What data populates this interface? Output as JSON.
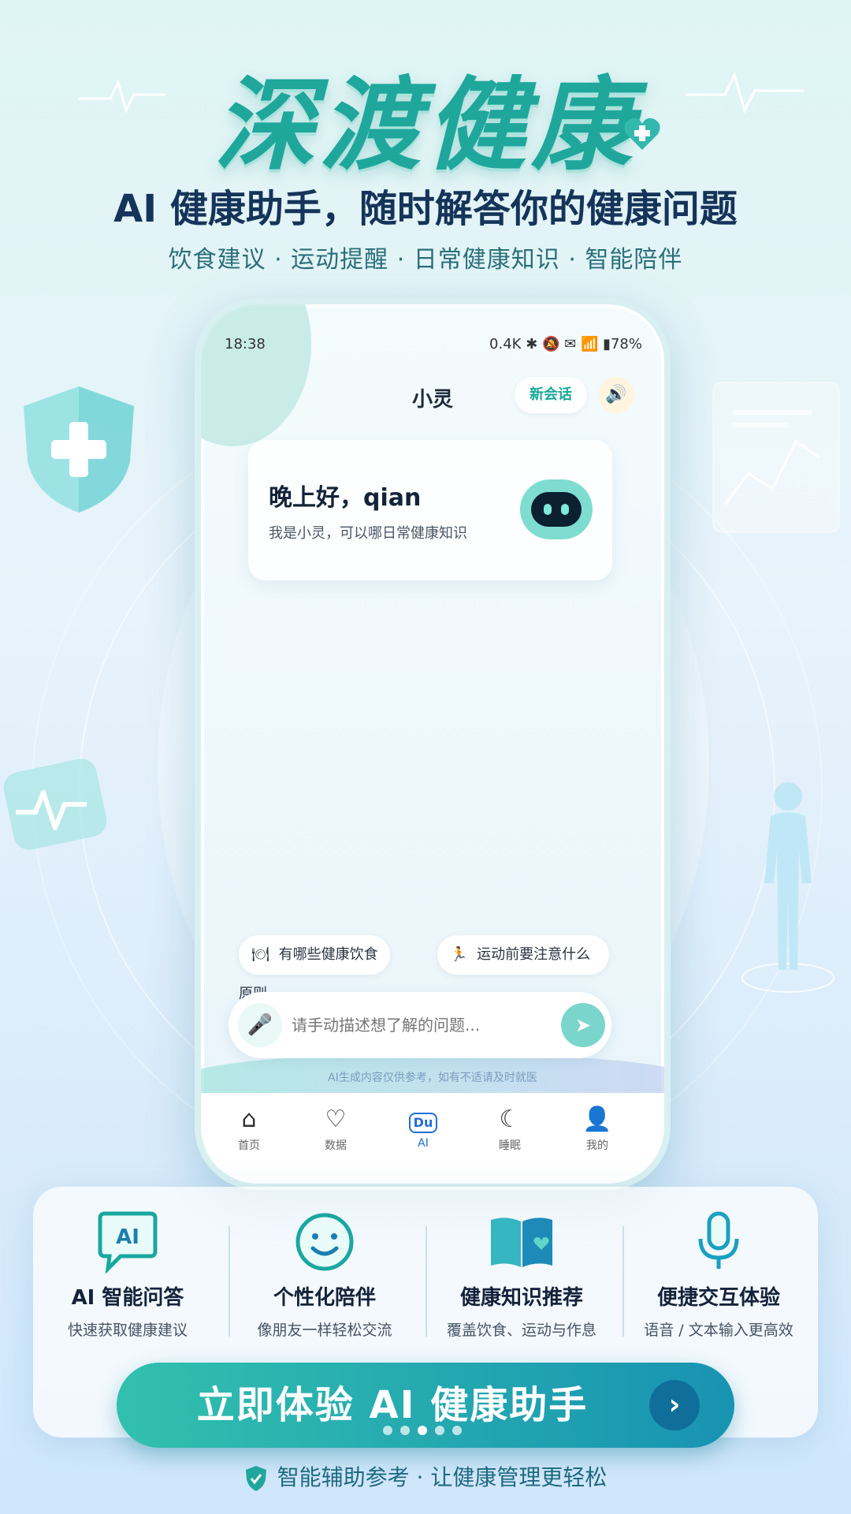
{
  "header": {
    "brand": "深渡健康",
    "subtitle": "AI 健康助手，随时解答你的健康问题",
    "tagline": "饮食建议 · 运动提醒 · 日常健康知识 · 智能陪伴"
  },
  "phone": {
    "status": {
      "time": "18:38",
      "right": "0.4K ✱ 🔕 ✉ 📶 ▮78%"
    },
    "title": "小灵",
    "new_chat": "新会话",
    "greeting": {
      "title": "晚上好，qian",
      "subtitle": "我是小灵，可以哪日常健康知识"
    },
    "chips": [
      {
        "icon": "🍽",
        "label": "有哪些健康饮食原则"
      },
      {
        "icon": "🏃",
        "label": "运动前要注意什么"
      }
    ],
    "input": {
      "placeholder": "请手动描述想了解的问题..."
    },
    "disclaimer": "AI生成内容仅供参考，如有不适请及时就医",
    "tabs": [
      {
        "label": "首页",
        "icon": "home-icon"
      },
      {
        "label": "数据",
        "icon": "heart-pulse-icon"
      },
      {
        "label": "AI",
        "icon": "du-icon",
        "badge": "Du",
        "active": true
      },
      {
        "label": "睡眠",
        "icon": "moon-icon"
      },
      {
        "label": "我的",
        "icon": "user-icon"
      }
    ]
  },
  "features": [
    {
      "icon": "ai-chat-icon",
      "glyph": "AI",
      "title": "AI 智能问答",
      "desc": "快速获取健康建议"
    },
    {
      "icon": "smile-icon",
      "glyph": "☺",
      "title": "个性化陪伴",
      "desc": "像朋友一样轻松交流"
    },
    {
      "icon": "book-icon",
      "glyph": "📖",
      "title": "健康知识推荐",
      "desc": "覆盖饮食、运动与作息"
    },
    {
      "icon": "microphone-icon",
      "glyph": "🎙",
      "title": "便捷交互体验",
      "desc": "语音 / 文本输入更高效"
    }
  ],
  "cta": {
    "label": "立即体验 AI 健康助手"
  },
  "carousel": {
    "count": 5,
    "active_index": 2
  },
  "footer": {
    "text": "智能辅助参考 · 让健康管理更轻松"
  }
}
